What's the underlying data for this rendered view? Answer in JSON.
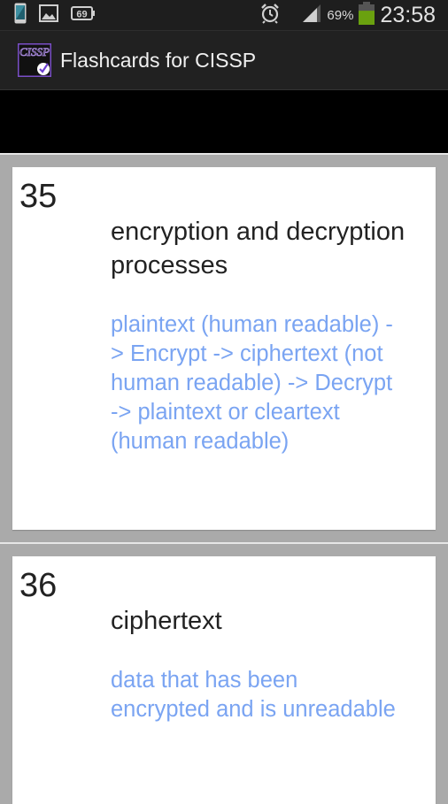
{
  "status_bar": {
    "left_icons": [
      "phone-screen-icon",
      "image-icon",
      "notification-count-icon"
    ],
    "notification_count": "69",
    "alarm_icon": "alarm-clock-icon",
    "signal_icon": "signal-strength-icon",
    "battery_percent": "69%",
    "battery_level": 0.69,
    "battery_color": "#6aa10f",
    "time": "23:58"
  },
  "action_bar": {
    "app_icon_label": "CISSP",
    "title": "Flashcards for CISSP"
  },
  "cards": [
    {
      "number": "35",
      "term": "encryption and decryption processes",
      "definition": "plaintext (human readable) -> Encrypt -> ciphertext (not human readable) -> Decrypt -> plaintext or cleartext (human readable)"
    },
    {
      "number": "36",
      "term": "ciphertext",
      "definition": "data that has been encrypted and is unreadable"
    }
  ],
  "colors": {
    "definition_text": "#7aa4f2",
    "term_text": "#222222",
    "background": "#aaaaaa"
  }
}
